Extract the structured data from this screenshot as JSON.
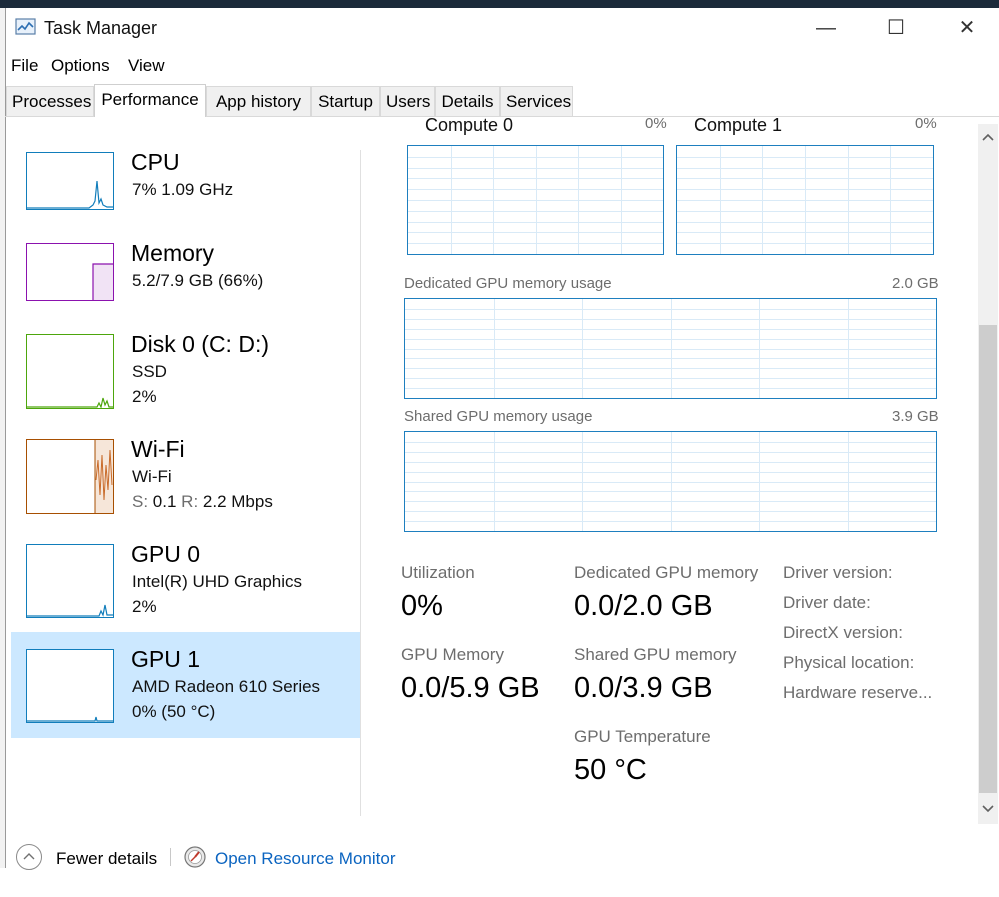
{
  "window": {
    "title": "Task Manager",
    "controls": {
      "minimize": "—",
      "maximize": "☐",
      "close": "✕"
    }
  },
  "menu": [
    "File",
    "Options",
    "View"
  ],
  "tabs": [
    {
      "label": "Processes",
      "active": false
    },
    {
      "label": "Performance",
      "active": true
    },
    {
      "label": "App history",
      "active": false
    },
    {
      "label": "Startup",
      "active": false
    },
    {
      "label": "Users",
      "active": false
    },
    {
      "label": "Details",
      "active": false
    },
    {
      "label": "Services",
      "active": false
    }
  ],
  "resources": [
    {
      "title": "CPU",
      "line1": "7%  1.09 GHz",
      "color": "#117dbb"
    },
    {
      "title": "Memory",
      "line1": "5.2/7.9 GB (66%)",
      "color": "#8b12ae"
    },
    {
      "title": "Disk 0 (C: D:)",
      "line1": "SSD",
      "line2": "2%",
      "color": "#4da60c"
    },
    {
      "title": "Wi-Fi",
      "line1": "Wi-Fi",
      "line2_s_label": "S:",
      "line2_s_value": "0.1",
      "line2_r_label": "R:",
      "line2_r_value": "2.2 Mbps",
      "color": "#a74f01"
    },
    {
      "title": "GPU 0",
      "line1": "Intel(R) UHD Graphics",
      "line2": "2%",
      "color": "#117dbb"
    },
    {
      "title": "GPU 1",
      "line1": "AMD Radeon 610 Series",
      "line2": "0% (50 °C)",
      "color": "#117dbb",
      "selected": true
    }
  ],
  "detail": {
    "compute_graphs": [
      {
        "label": "Compute 0",
        "value": "0%"
      },
      {
        "label": "Compute 1",
        "value": "0%"
      }
    ],
    "dedicated_graph": {
      "label": "Dedicated GPU memory usage",
      "max": "2.0 GB"
    },
    "shared_graph": {
      "label": "Shared GPU memory usage",
      "max": "3.9 GB"
    },
    "stats": {
      "utilization": {
        "label": "Utilization",
        "value": "0%"
      },
      "dedicated": {
        "label": "Dedicated GPU memory",
        "value": "0.0/2.0 GB"
      },
      "gpu_memory": {
        "label": "GPU Memory",
        "value": "0.0/5.9 GB"
      },
      "shared": {
        "label": "Shared GPU memory",
        "value": "0.0/3.9 GB"
      },
      "temperature": {
        "label": "GPU Temperature",
        "value": "50 °C"
      }
    },
    "info": [
      "Driver version:",
      "Driver date:",
      "DirectX version:",
      "Physical location:",
      "Hardware reserve..."
    ]
  },
  "footer": {
    "fewer_details": "Fewer details",
    "open_resource_monitor": "Open Resource Monitor"
  },
  "colors": {
    "graph_border": "#1e7fbf",
    "grid": "#d9eaf7",
    "selected_bg": "#cce8ff",
    "link": "#0b64c0"
  },
  "icons": [
    "task-manager-icon",
    "chevron-up-icon",
    "resource-monitor-icon",
    "scroll-up-arrow-icon",
    "scroll-down-arrow-icon"
  ]
}
